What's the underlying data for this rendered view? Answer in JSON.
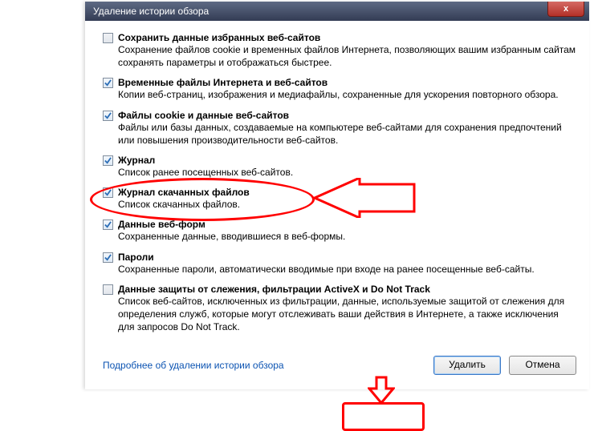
{
  "window": {
    "title": "Удаление истории обзора",
    "close_icon": "x"
  },
  "options": [
    {
      "checked": false,
      "label": "Сохранить данные избранных веб-сайтов",
      "desc": "Сохранение файлов cookie и временных файлов Интернета, позволяющих вашим избранным сайтам сохранять параметры и отображаться быстрее."
    },
    {
      "checked": true,
      "label": "Временные файлы Интернета и веб-сайтов",
      "desc": "Копии веб-страниц, изображения и медиафайлы, сохраненные для ускорения повторного обзора."
    },
    {
      "checked": true,
      "label": "Файлы cookie и данные веб-сайтов",
      "desc": "Файлы или базы данных, создаваемые на компьютере веб-сайтами для сохранения предпочтений или повышения производительности веб-сайтов."
    },
    {
      "checked": true,
      "label": "Журнал",
      "desc": "Список ранее посещенных веб-сайтов."
    },
    {
      "checked": true,
      "label": "Журнал скачанных файлов",
      "desc": "Список скачанных файлов."
    },
    {
      "checked": true,
      "label": "Данные веб-форм",
      "desc": "Сохраненные данные, вводившиеся в веб-формы."
    },
    {
      "checked": true,
      "label": "Пароли",
      "desc": "Сохраненные пароли, автоматически вводимые при входе на ранее посещенные веб-сайты."
    },
    {
      "checked": false,
      "label": "Данные защиты от слежения, фильтрации ActiveX и Do Not Track",
      "desc": "Список веб-сайтов, исключенных из фильтрации, данные, используемые защитой от слежения для определения служб, которые могут отслеживать ваши действия в Интернете, а также исключения для запросов Do Not Track."
    }
  ],
  "link": "Подробнее об удалении истории обзора",
  "buttons": {
    "delete": "Удалить",
    "cancel": "Отмена"
  },
  "annotations": {
    "highlight_option": "journal",
    "highlight_button": "delete",
    "arrow_large": true,
    "arrow_small": true
  }
}
